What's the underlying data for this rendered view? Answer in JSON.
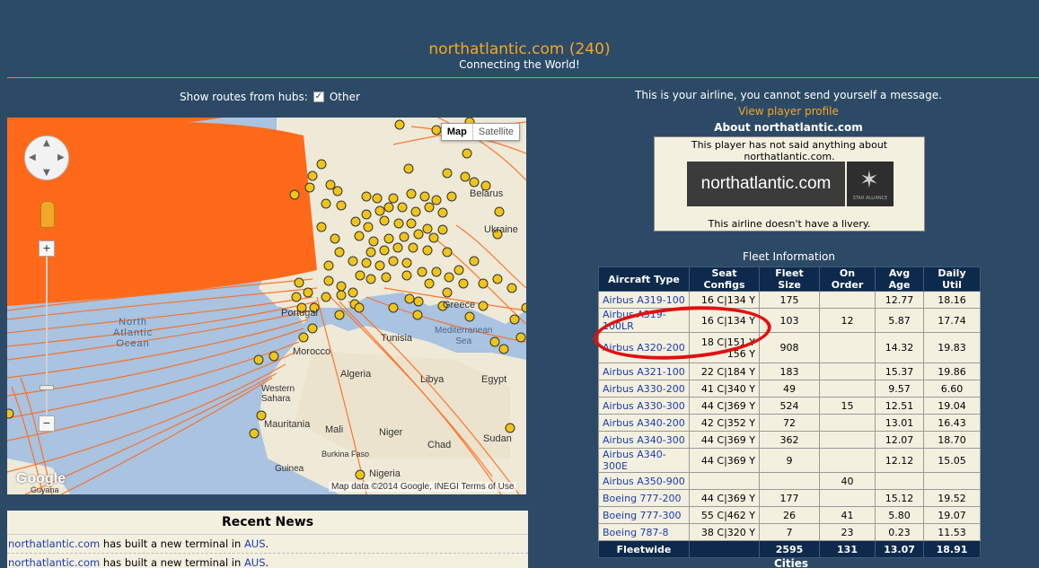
{
  "header": {
    "title": "northatlantic.com (240)",
    "subtitle": "Connecting the World!"
  },
  "hubs_filter": {
    "label": "Show routes from hubs:",
    "option": "Other",
    "checked": true
  },
  "map": {
    "type_buttons": {
      "map": "Map",
      "satellite": "Satellite"
    },
    "zoom_in": "+",
    "zoom_out": "−",
    "labels": {
      "north_atlantic_1": "North",
      "north_atlantic_2": "Atlantic",
      "north_atlantic_3": "Ocean",
      "belarus": "Belarus",
      "ukraine": "Ukraine",
      "portugal": "Portugal",
      "greece": "Greece",
      "tunisia": "Tunisia",
      "mediterranean_1": "Mediterranean",
      "mediterranean_2": "Sea",
      "morocco": "Morocco",
      "algeria": "Algeria",
      "libya": "Libya",
      "egypt": "Egypt",
      "western_sahara_1": "Western",
      "western_sahara_2": "Sahara",
      "mauritania": "Mauritania",
      "mali": "Mali",
      "niger": "Niger",
      "chad": "Chad",
      "sudan": "Sudan",
      "burkina": "Burkina Faso",
      "guinea": "Guinea",
      "nigeria": "Nigeria",
      "guyana": "Guyana"
    },
    "google_logo": "Google",
    "attribution": "Map data ©2014 Google, INEGI   Terms of Use",
    "colors": {
      "routes": "#ff6a1a",
      "land": "#efe9d8",
      "water": "#a9c3e0",
      "marker": "#f0c419"
    }
  },
  "news": {
    "title": "Recent News",
    "items": [
      {
        "airline": "northatlantic.com",
        "text": " has built a new terminal in ",
        "city": "AUS",
        "end": "."
      },
      {
        "airline": "northatlantic.com",
        "text": " has built a new terminal in ",
        "city": "AUS",
        "end": "."
      }
    ]
  },
  "profile": {
    "message": "This is your airline, you cannot send yourself a message.",
    "view_profile": "View player profile",
    "about_title": "About northatlantic.com",
    "about_text": "This player has not said anything about northatlantic.com.",
    "logo_text": "northatlantic.com",
    "alliance_label": "STAR ALLIANCE",
    "livery_text": "This airline doesn't have a livery."
  },
  "fleet": {
    "title": "Fleet Information",
    "headers": [
      "Aircraft Type",
      "Seat Configs",
      "Fleet Size",
      "On Order",
      "Avg Age",
      "Daily Util"
    ],
    "rows": [
      {
        "type": "Airbus A319-100",
        "seats": "16 C|134 Y",
        "size": "175",
        "order": "",
        "age": "12.77",
        "util": "18.16"
      },
      {
        "type": "Airbus A319-100LR",
        "seats": "16 C|134 Y",
        "size": "103",
        "order": "12",
        "age": "5.87",
        "util": "17.74"
      },
      {
        "type": "Airbus A320-200",
        "seats": "18 C|151 Y",
        "seats2": "156 Y",
        "size": "908",
        "order": "",
        "age": "14.32",
        "util": "19.83"
      },
      {
        "type": "Airbus A321-100",
        "seats": "22 C|184 Y",
        "size": "183",
        "order": "",
        "age": "15.37",
        "util": "19.86"
      },
      {
        "type": "Airbus A330-200",
        "seats": "41 C|340 Y",
        "size": "49",
        "order": "",
        "age": "9.57",
        "util": "6.60"
      },
      {
        "type": "Airbus A330-300",
        "seats": "44 C|369 Y",
        "size": "524",
        "order": "15",
        "age": "12.51",
        "util": "19.04"
      },
      {
        "type": "Airbus A340-200",
        "seats": "42 C|352 Y",
        "size": "72",
        "order": "",
        "age": "13.01",
        "util": "16.43"
      },
      {
        "type": "Airbus A340-300",
        "seats": "44 C|369 Y",
        "size": "362",
        "order": "",
        "age": "12.07",
        "util": "18.70"
      },
      {
        "type": "Airbus A340-300E",
        "seats": "44 C|369 Y",
        "size": "9",
        "order": "",
        "age": "12.12",
        "util": "15.05"
      },
      {
        "type": "Airbus A350-900",
        "seats": "",
        "size": "",
        "order": "40",
        "age": "",
        "util": ""
      },
      {
        "type": "Boeing 777-200",
        "seats": "44 C|369 Y",
        "size": "177",
        "order": "",
        "age": "15.12",
        "util": "19.52"
      },
      {
        "type": "Boeing 777-300",
        "seats": "55 C|462 Y",
        "size": "26",
        "order": "41",
        "age": "5.80",
        "util": "19.07"
      },
      {
        "type": "Boeing 787-8",
        "seats": "38 C|320 Y",
        "size": "7",
        "order": "23",
        "age": "0.23",
        "util": "11.53"
      }
    ],
    "total": {
      "label": "Fleetwide",
      "seats": "",
      "size": "2595",
      "order": "131",
      "age": "13.07",
      "util": "18.91"
    }
  },
  "cities_title": "Cities"
}
